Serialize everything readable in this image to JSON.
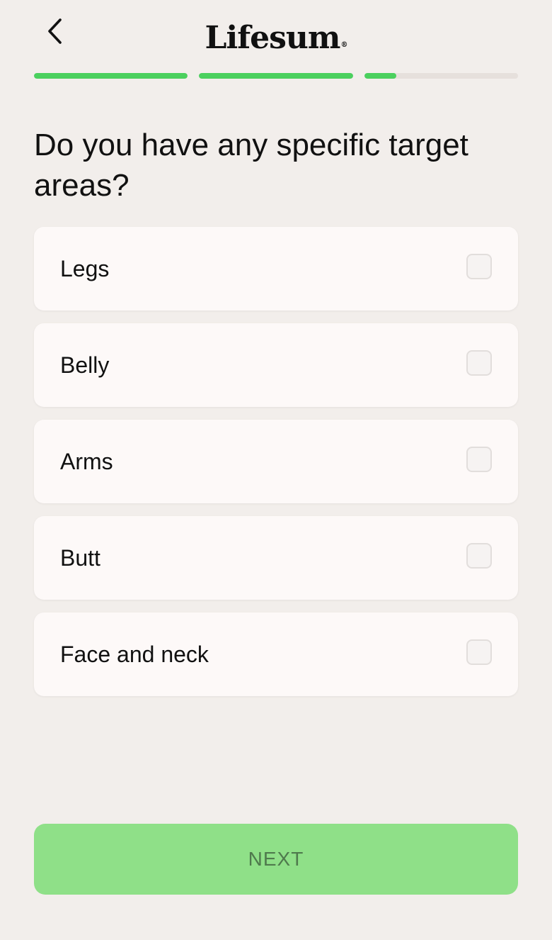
{
  "header": {
    "brand": "Lifesum",
    "registered_mark": "®",
    "back_icon": "chevron-left-icon"
  },
  "progress": {
    "segments": [
      {
        "fill_fraction": 1.0
      },
      {
        "fill_fraction": 1.0
      },
      {
        "fill_fraction": 0.21
      }
    ],
    "fill_color": "#4bd05e",
    "track_color": "#e6e0dc"
  },
  "question": {
    "title": "Do you have any specific target areas?"
  },
  "options": [
    {
      "label": "Legs",
      "checked": false
    },
    {
      "label": "Belly",
      "checked": false
    },
    {
      "label": "Arms",
      "checked": false
    },
    {
      "label": "Butt",
      "checked": false
    },
    {
      "label": "Face and neck",
      "checked": false
    }
  ],
  "next_button": {
    "label": "NEXT",
    "enabled": false,
    "color": "#8fe088"
  }
}
